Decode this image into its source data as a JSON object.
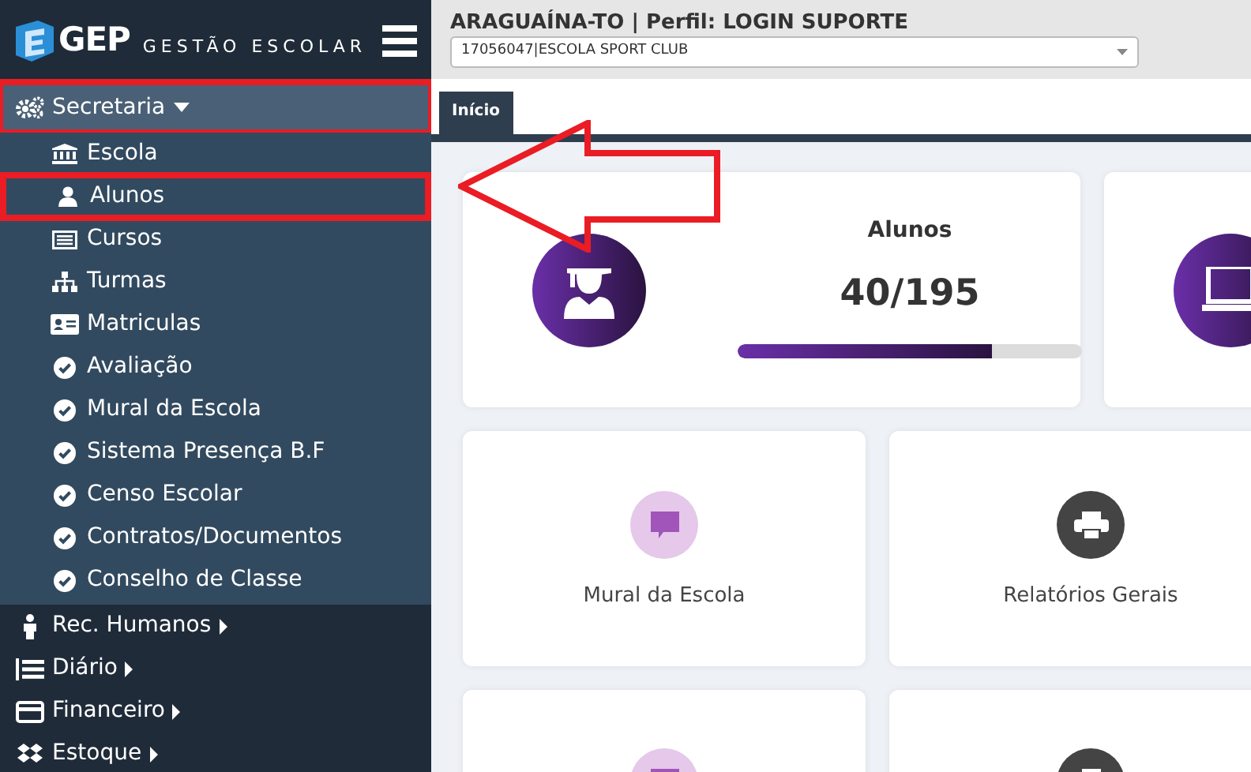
{
  "brand": {
    "logo": "GEP",
    "subtitle": "GESTÃO ESCOLAR"
  },
  "sidebar": {
    "items": [
      {
        "label": "Secretaria",
        "expanded": true,
        "annotated": true,
        "children": [
          {
            "label": "Escola",
            "annotated": false
          },
          {
            "label": "Alunos",
            "annotated": true
          },
          {
            "label": "Cursos",
            "annotated": false
          },
          {
            "label": "Turmas",
            "annotated": false
          },
          {
            "label": "Matriculas",
            "annotated": false
          },
          {
            "label": "Avaliação",
            "annotated": false
          },
          {
            "label": "Mural da Escola",
            "annotated": false
          },
          {
            "label": "Sistema Presença B.F",
            "annotated": false
          },
          {
            "label": "Censo Escolar",
            "annotated": false
          },
          {
            "label": "Contratos/Documentos",
            "annotated": false
          },
          {
            "label": "Conselho de Classe",
            "annotated": false
          }
        ]
      },
      {
        "label": "Rec. Humanos",
        "expanded": false,
        "annotated": false
      },
      {
        "label": "Diário",
        "expanded": false,
        "annotated": false
      },
      {
        "label": "Financeiro",
        "expanded": false,
        "annotated": false
      },
      {
        "label": "Estoque",
        "expanded": false,
        "annotated": false
      }
    ]
  },
  "header": {
    "title": "ARAGUAÍNA-TO | Perfil: LOGIN SUPORTE",
    "school_select": "17056047|ESCOLA SPORT CLUB"
  },
  "tabs": [
    {
      "label": "Início",
      "selected": true
    }
  ],
  "cards": [
    {
      "kind": "stat",
      "title": "Alunos",
      "value": "40/195",
      "level": 0.74
    },
    {
      "kind": "stat"
    },
    {
      "kind": "link",
      "label": "Mural da Escola"
    },
    {
      "kind": "link",
      "label": "Relatórios Gerais"
    },
    {
      "kind": "link"
    },
    {
      "kind": "link"
    }
  ]
}
